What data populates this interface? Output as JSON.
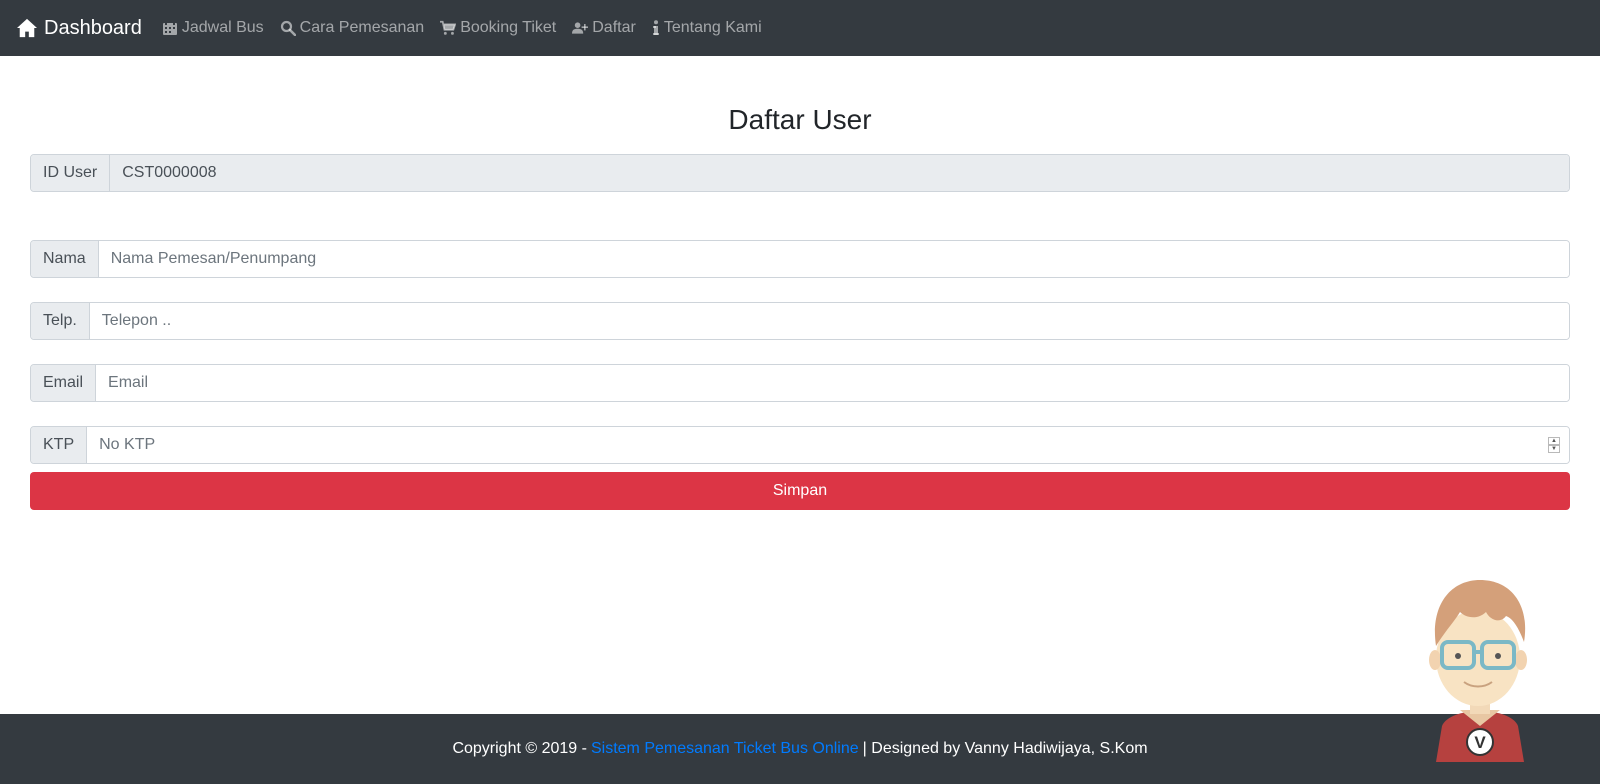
{
  "navbar": {
    "brand": "Dashboard",
    "items": [
      {
        "label": "Jadwal Bus",
        "icon": "calendar-icon"
      },
      {
        "label": "Cara Pemesanan",
        "icon": "search-icon"
      },
      {
        "label": "Booking Tiket",
        "icon": "cart-icon"
      },
      {
        "label": "Daftar",
        "icon": "user-plus-icon"
      },
      {
        "label": "Tentang Kami",
        "icon": "info-icon"
      }
    ]
  },
  "form": {
    "title": "Daftar User",
    "id_user": {
      "label": "ID User",
      "value": "CST0000008"
    },
    "nama": {
      "label": "Nama",
      "placeholder": "Nama Pemesan/Penumpang"
    },
    "telp": {
      "label": "Telp.",
      "placeholder": "Telepon .."
    },
    "email": {
      "label": "Email",
      "placeholder": "Email"
    },
    "ktp": {
      "label": "KTP",
      "placeholder": "No KTP"
    },
    "submit_label": "Simpan"
  },
  "footer": {
    "prefix": "Copyright © 2019 -",
    "link": "Sistem Pemesanan Ticket Bus Online",
    "suffix": "| Designed by Vanny Hadiwijaya, S.Kom"
  },
  "mascot": {
    "badge": "V"
  },
  "colors": {
    "navbar_bg": "#343a40",
    "button_danger": "#dc3545",
    "link": "#007bff"
  }
}
